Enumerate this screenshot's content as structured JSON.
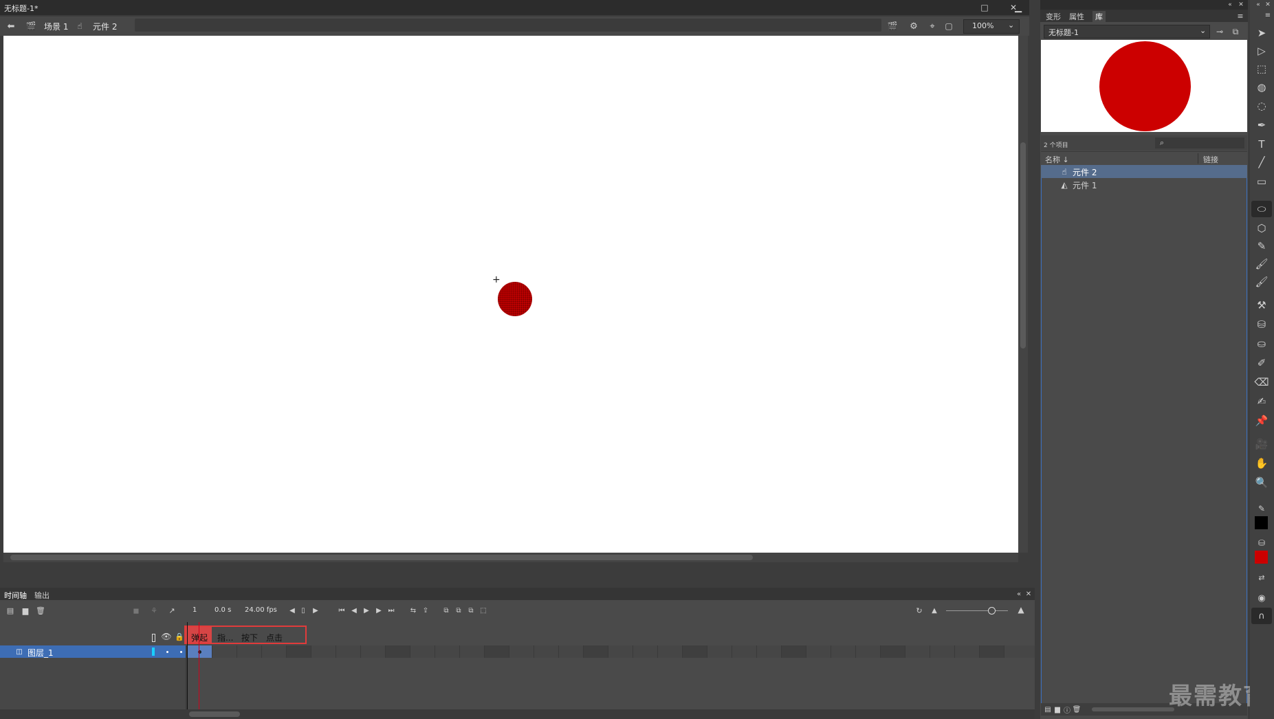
{
  "document": {
    "title": "无标题-1*",
    "window_controls": {
      "minimize": "▁",
      "maximize": "□",
      "close": "✕"
    },
    "breadcrumb": {
      "scene": "场景 1",
      "symbol": "元件 2"
    },
    "zoom": "100%"
  },
  "timeline": {
    "tabs": [
      "时间轴",
      "输出"
    ],
    "current_frame": "1",
    "time": "0.0 s",
    "fps": "24.00 fps",
    "frame_states": [
      "弹起",
      "指...",
      "按下",
      "点击"
    ],
    "layer": {
      "name": "图层_1"
    }
  },
  "right_panel": {
    "tabs": [
      "变形",
      "属性",
      "库"
    ],
    "library": {
      "document_name": "无标题-1",
      "item_count": "2 个项目",
      "columns": {
        "name": "名称 ↓",
        "linkage": "链接"
      },
      "items": [
        {
          "name": "元件 2",
          "icon": "button-symbol-icon",
          "selected": true
        },
        {
          "name": "元件 1",
          "icon": "graphic-symbol-icon",
          "selected": false
        }
      ]
    }
  },
  "watermark": "最需教育",
  "colors": {
    "accent": "#3d6db5",
    "symbol_fill": "#cc0000",
    "stroke": "#000000",
    "frame_state_highlight": "#e23b3b"
  }
}
